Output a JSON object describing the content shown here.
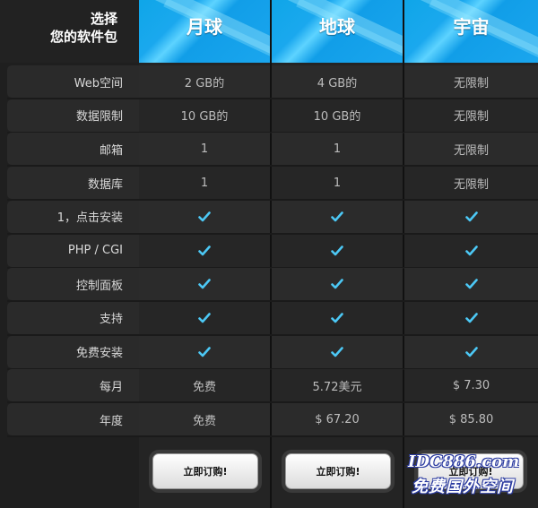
{
  "header": {
    "choose_line1": "选择",
    "choose_line2": "您的软件包"
  },
  "plans": [
    "月球",
    "地球",
    "宇宙"
  ],
  "rows": [
    {
      "label": "Web空间",
      "values": [
        "2 GB的",
        "4 GB的",
        "无限制"
      ]
    },
    {
      "label": "数据限制",
      "values": [
        "10 GB的",
        "10 GB的",
        "无限制"
      ]
    },
    {
      "label": "邮箱",
      "values": [
        "1",
        "1",
        "无限制"
      ]
    },
    {
      "label": "数据库",
      "values": [
        "1",
        "1",
        "无限制"
      ]
    },
    {
      "label": "1，点击安装",
      "values": [
        "check",
        "check",
        "check"
      ]
    },
    {
      "label": "PHP / CGI",
      "values": [
        "check",
        "check",
        "check"
      ]
    },
    {
      "label": "控制面板",
      "values": [
        "check",
        "check",
        "check"
      ]
    },
    {
      "label": "支持",
      "values": [
        "check",
        "check",
        "check"
      ]
    },
    {
      "label": "免费安装",
      "values": [
        "check",
        "check",
        "check"
      ]
    },
    {
      "label": "每月",
      "values": [
        "免费",
        "5.72美元",
        "$ 7.30"
      ]
    },
    {
      "label": "年度",
      "values": [
        "免费",
        "$ 67.20",
        "$ 85.80"
      ]
    }
  ],
  "order_button_label": "立即订购!",
  "watermark": {
    "line1": "IDC886.com",
    "line2": "免费国外空间"
  },
  "colors": {
    "accent": "#1aa6ee",
    "check": "#4cc8f5"
  },
  "icons": {
    "check": "checkmark-icon"
  }
}
